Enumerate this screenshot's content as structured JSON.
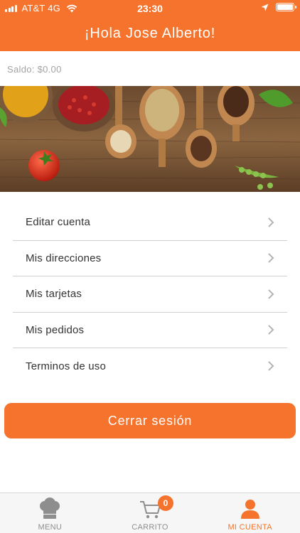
{
  "status_bar": {
    "carrier": "AT&T 4G",
    "time": "23:30",
    "icons": [
      "signal-icon",
      "wifi-icon",
      "location-icon",
      "battery-icon"
    ]
  },
  "header": {
    "title": "¡Hola Jose Alberto!"
  },
  "account": {
    "balance": "Saldo: $0.00"
  },
  "menu": {
    "items": [
      {
        "label": "Editar cuenta"
      },
      {
        "label": "Mis direcciones"
      },
      {
        "label": "Mis tarjetas"
      },
      {
        "label": "Mis pedidos"
      },
      {
        "label": "Terminos de uso"
      }
    ]
  },
  "actions": {
    "logout_label": "Cerrar sesión"
  },
  "tabbar": {
    "tabs": [
      {
        "label": "MENU",
        "icon": "chef-hat-icon"
      },
      {
        "label": "CARRITO",
        "icon": "cart-icon",
        "badge": "0"
      },
      {
        "label": "MI CUENTA",
        "icon": "user-icon",
        "active": true
      }
    ]
  },
  "colors": {
    "accent": "#f5732c",
    "divider": "#cfcfcf",
    "muted_text": "#a3a3a3",
    "tab_inactive": "#8e8e8e"
  }
}
